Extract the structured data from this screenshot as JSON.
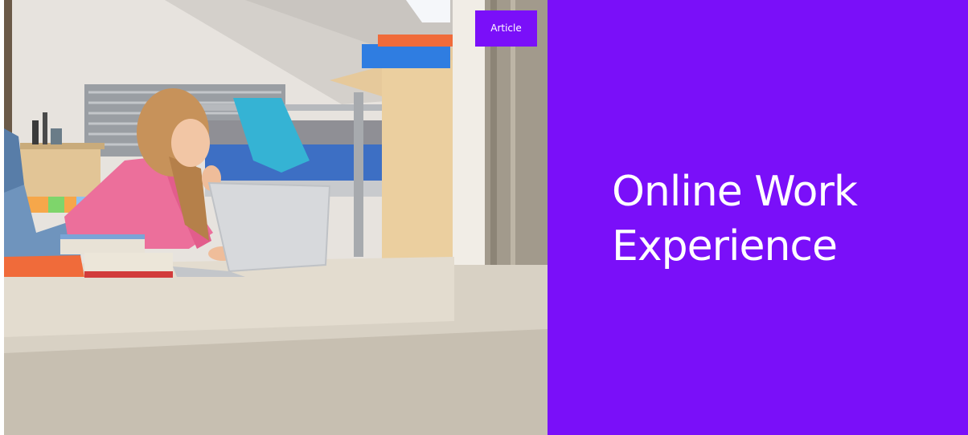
{
  "card": {
    "badge_label": "Article",
    "title": "Online Work Experience",
    "accent_color": "#7a0ff9",
    "image_subject": "student-studying-on-laptop-in-bedroom"
  }
}
